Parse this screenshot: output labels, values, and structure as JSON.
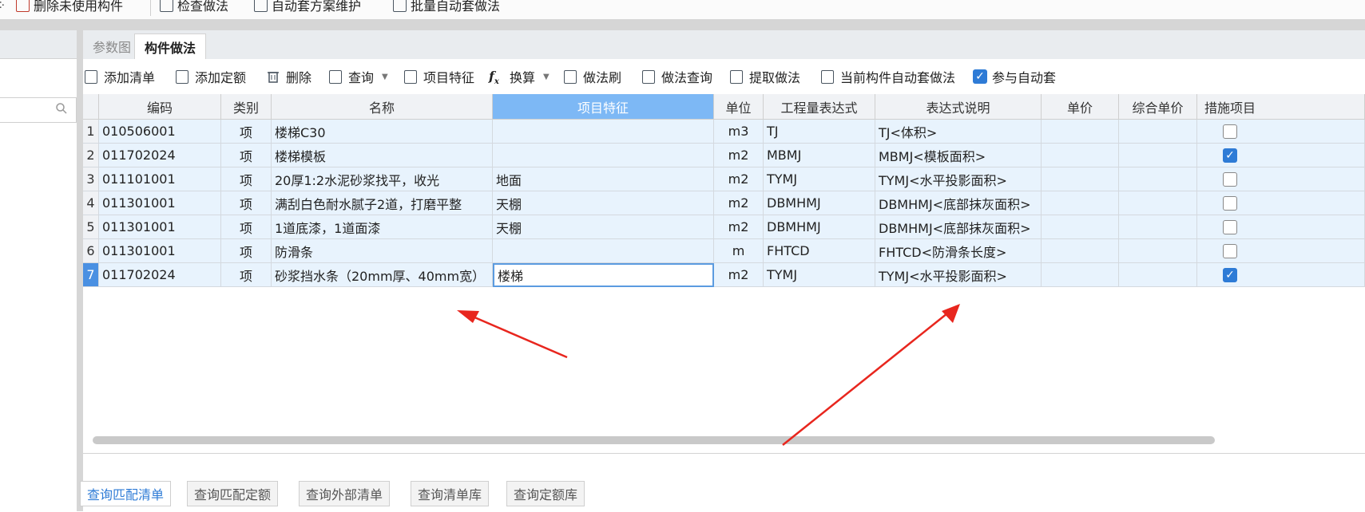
{
  "top_toolbar": {
    "items": [
      {
        "label": "删除未使用构件",
        "icon": "list-delete-icon"
      },
      {
        "label": "检查做法",
        "icon": "check-method-icon"
      },
      {
        "label": "自动套方案维护",
        "icon": "scheme-icon"
      },
      {
        "label": "批量自动套做法",
        "icon": "batch-icon"
      }
    ]
  },
  "tabs": [
    {
      "label": "参数图",
      "active": false
    },
    {
      "label": "构件做法",
      "active": true
    }
  ],
  "toolbar": {
    "add_list": "添加清单",
    "add_quota": "添加定额",
    "delete": "删除",
    "query": "查询",
    "item_feature": "项目特征",
    "convert": "换算",
    "method_brush": "做法刷",
    "method_query": "做法查询",
    "extract_method": "提取做法",
    "auto_method_current": "当前构件自动套做法",
    "join_auto": "参与自动套",
    "join_auto_checked": true
  },
  "grid": {
    "columns": [
      "编码",
      "类别",
      "名称",
      "项目特征",
      "单位",
      "工程量表达式",
      "表达式说明",
      "单价",
      "综合单价",
      "措施项目"
    ],
    "selected_column": "项目特征",
    "rows": [
      {
        "no": "1",
        "code": "010506001",
        "type": "项",
        "name": "楼梯C30",
        "feature": "",
        "unit": "m3",
        "expr": "TJ",
        "desc": "TJ<体积>",
        "price": "",
        "comp_price": "",
        "measure": false
      },
      {
        "no": "2",
        "code": "011702024",
        "type": "项",
        "name": "楼梯模板",
        "feature": "",
        "unit": "m2",
        "expr": "MBMJ",
        "desc": "MBMJ<模板面积>",
        "price": "",
        "comp_price": "",
        "measure": true
      },
      {
        "no": "3",
        "code": "011101001",
        "type": "项",
        "name": "20厚1:2水泥砂浆找平，收光",
        "feature": "地面",
        "unit": "m2",
        "expr": "TYMJ",
        "desc": "TYMJ<水平投影面积>",
        "price": "",
        "comp_price": "",
        "measure": false
      },
      {
        "no": "4",
        "code": "011301001",
        "type": "项",
        "name": "满刮白色耐水腻子2道，打磨平整",
        "feature": "天棚",
        "unit": "m2",
        "expr": "DBMHMJ",
        "desc": "DBMHMJ<底部抹灰面积>",
        "price": "",
        "comp_price": "",
        "measure": false
      },
      {
        "no": "5",
        "code": "011301001",
        "type": "项",
        "name": "1道底漆，1道面漆",
        "feature": "天棚",
        "unit": "m2",
        "expr": "DBMHMJ",
        "desc": "DBMHMJ<底部抹灰面积>",
        "price": "",
        "comp_price": "",
        "measure": false
      },
      {
        "no": "6",
        "code": "011301001",
        "type": "项",
        "name": "防滑条",
        "feature": "",
        "unit": "m",
        "expr": "FHTCD",
        "desc": "FHTCD<防滑条长度>",
        "price": "",
        "comp_price": "",
        "measure": false
      },
      {
        "no": "7",
        "code": "011702024",
        "type": "项",
        "name": "砂浆挡水条（20mm厚、40mm宽）",
        "feature": "楼梯",
        "unit": "m2",
        "expr": "TYMJ",
        "desc": "TYMJ<水平投影面积>",
        "price": "",
        "comp_price": "",
        "measure": true
      }
    ],
    "current_row": "7"
  },
  "bottom_tabs": [
    "查询匹配清单",
    "查询匹配定额",
    "查询外部清单",
    "查询清单库",
    "查询定额库"
  ],
  "colors": {
    "accent": "#2e7bd6",
    "row_bg": "#e8f3fd",
    "selected_header": "#7db8f5",
    "arrow": "#e8261e"
  }
}
